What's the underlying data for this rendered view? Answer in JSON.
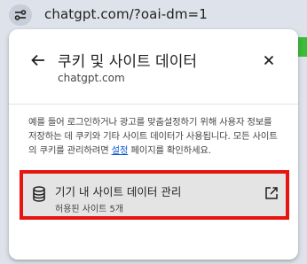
{
  "address_bar": {
    "url": "chatgpt.com/?oai-dm=1",
    "site_info_icon": "tune-icon"
  },
  "popup": {
    "title": "쿠키 및 사이트 데이터",
    "subtitle": "chatgpt.com",
    "back_icon": "arrow-left-icon",
    "close_icon": "close-icon",
    "description_before_link": "예를 들어 로그인하거나 광고를 맞춤설정하기 위해 사용자 정보를 저장하는 데 쿠키와 기타 사이트 데이터가 사용됩니다. 모든 사이트의 쿠키를 관리하려면 ",
    "description_link": "설정",
    "description_after_link": " 페이지를 확인하세요.",
    "manage": {
      "title": "기기 내 사이트 데이터 관리",
      "subtitle": "허용된 사이트 5개",
      "icon": "database-icon",
      "external_icon": "open-in-new-icon",
      "highlight_color": "#e8140f"
    }
  },
  "colors": {
    "link": "#0b57d0",
    "toolbar": "#dee3eb",
    "row_background": "#e4e4e4"
  }
}
